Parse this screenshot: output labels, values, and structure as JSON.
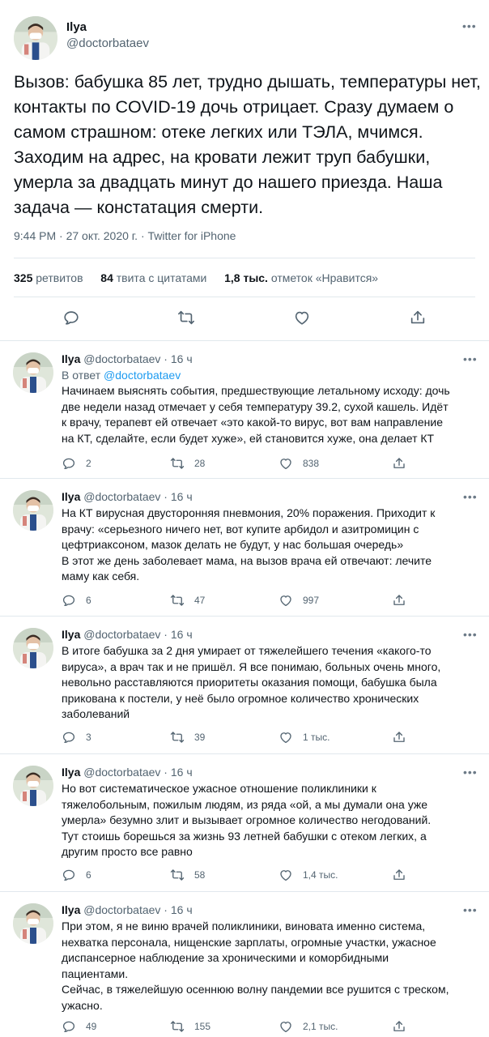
{
  "main": {
    "name": "Ilya",
    "handle": "@doctorbataev",
    "text": "Вызов: бабушка 85 лет, трудно дышать, температуры нет, контакты по COVID-19 дочь отрицает. Сразу думаем о самом страшном: отеке легких или ТЭЛА, мчимся. Заходим на адрес, на кровати лежит труп бабушки, умерла за двадцать минут до нашего приезда. Наша задача — констатация смерти.",
    "meta": "9:44 PM · 27 окт. 2020 г. · Twitter for iPhone",
    "stats": {
      "retweets_count": "325",
      "retweets_label": "ретвитов",
      "quotes_count": "84",
      "quotes_label": "твита с цитатами",
      "likes_count": "1,8 тыс.",
      "likes_label": "отметок «Нравится»"
    }
  },
  "replies": [
    {
      "name": "Ilya",
      "handle": "@doctorbataev",
      "dot": "·",
      "time": "16 ч",
      "in_reply_prefix": "В ответ",
      "in_reply_handle": "@doctorbataev",
      "text": "Начинаем выяснять события, предшествующие летальному исходу: дочь\nдве недели назад отмечает у себя температуру 39.2, сухой кашель. Идёт\nк врачу, терапевт ей отвечает «это какой-то вирус, вот вам направление\nна КТ, сделайте, если будет хуже», ей становится хуже, она делает КТ",
      "replies": "2",
      "retweets": "28",
      "likes": "838"
    },
    {
      "name": "Ilya",
      "handle": "@doctorbataev",
      "dot": "·",
      "time": "16 ч",
      "text": "На КТ вирусная двусторонняя пневмония, 20% поражения. Приходит к\nврачу: «серьезного ничего нет, вот купите арбидол и азитромицин с\nцефтриаксоном, мазок делать не будут, у нас большая очередь»\nВ этот же день заболевает мама, на  вызов врача ей отвечают: лечите\nмаму как себя.",
      "replies": "6",
      "retweets": "47",
      "likes": "997"
    },
    {
      "name": "Ilya",
      "handle": "@doctorbataev",
      "dot": "·",
      "time": "16 ч",
      "text": "В итоге бабушка за 2 дня умирает от тяжелейшего течения «какого-то\nвируса», а врач так и не пришёл. Я все понимаю, больных очень много,\nневольно расставляются приоритеты оказания помощи, бабушка была\nприкована к постели, у неё было огромное количество хронических\nзаболеваний",
      "replies": "3",
      "retweets": "39",
      "likes": "1 тыс."
    },
    {
      "name": "Ilya",
      "handle": "@doctorbataev",
      "dot": "·",
      "time": "16 ч",
      "text": "Но вот систематическое ужасное  отношение поликлиники к\nтяжелобольным, пожилым людям, из ряда «ой, а мы думали она уже\nумерла» безумно злит и вызывает огромное количество негодований.\nТут стоишь борешься за жизнь 93 летней бабушки с отеком легких, а\nдругим просто все равно",
      "replies": "6",
      "retweets": "58",
      "likes": "1,4 тыс."
    },
    {
      "name": "Ilya",
      "handle": "@doctorbataev",
      "dot": "·",
      "time": "16 ч",
      "text": "При этом, я не виню врачей поликлиники, виновата именно система,\nнехватка персонала, нищенские зарплаты, огромные участки, ужасное\nдиспансерное наблюдение за хроническими и коморбидными\nпациентами.\nСейчас, в тяжелейшую осеннюю волну пандемии все рушится с треском,\nужасно.",
      "replies": "49",
      "retweets": "155",
      "likes": "2,1 тыс."
    }
  ],
  "icons": [
    "reply-icon",
    "retweet-icon",
    "like-icon",
    "share-icon",
    "more-icon"
  ],
  "colors": {
    "link": "#1d9bf0",
    "secondary": "#536471",
    "text": "#0f1419",
    "divider": "#e1e8ed"
  }
}
